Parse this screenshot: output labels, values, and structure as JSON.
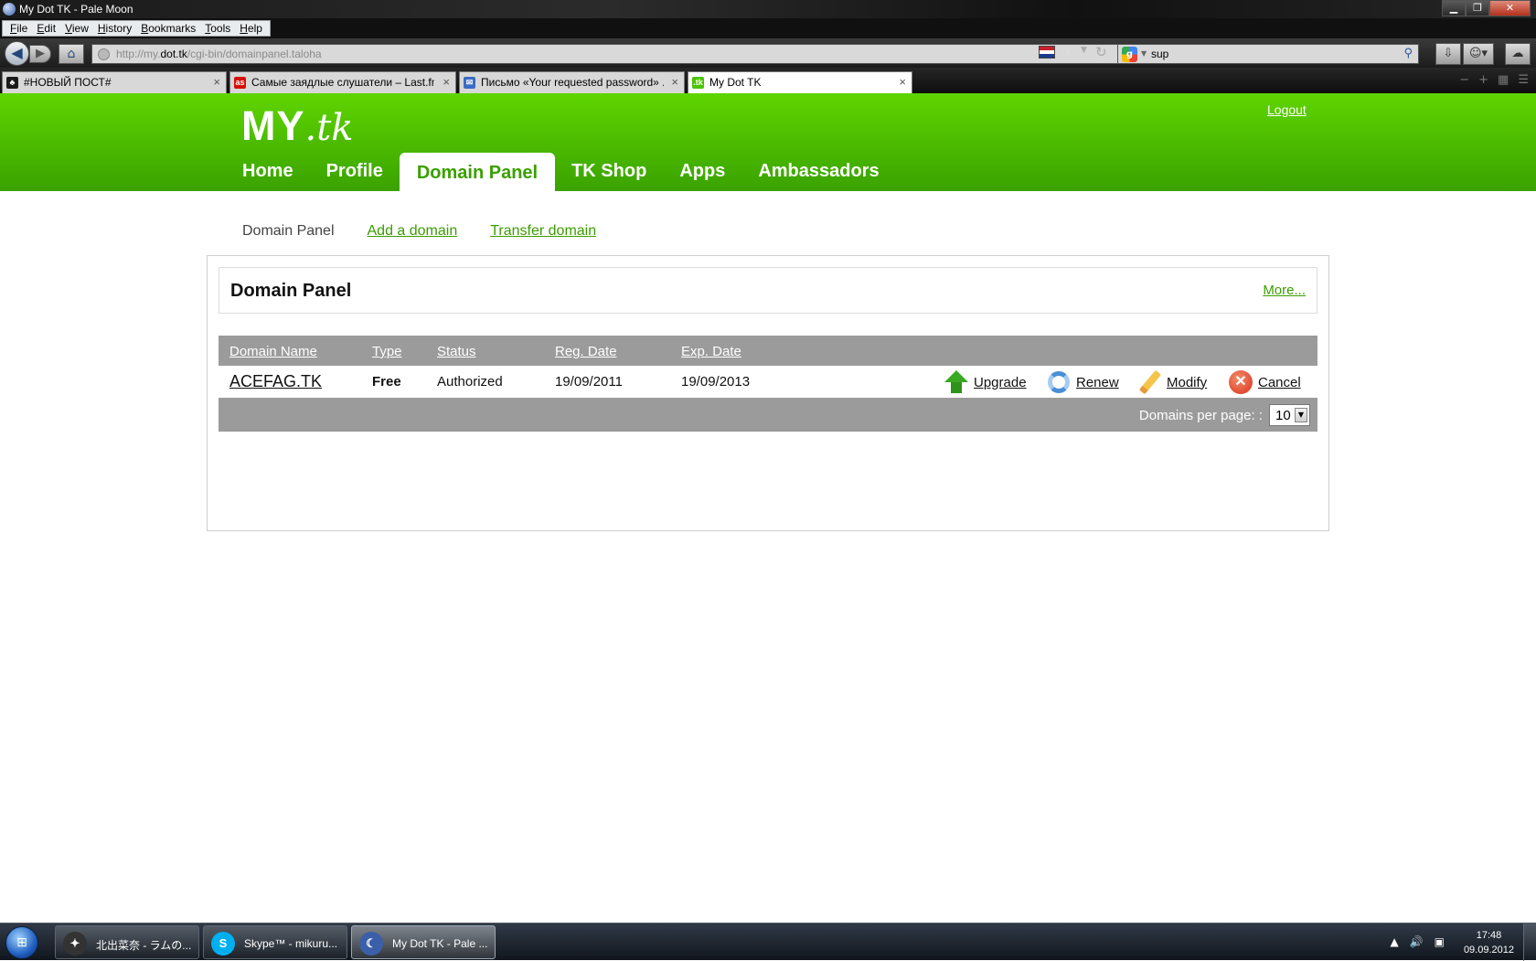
{
  "window": {
    "title": "My Dot TK - Pale Moon",
    "minimize": "▁",
    "restore": "❐",
    "close": "✕"
  },
  "menu": [
    "File",
    "Edit",
    "View",
    "History",
    "Bookmarks",
    "Tools",
    "Help"
  ],
  "urlbar": {
    "url_prefix": "http://my.",
    "url_domain": "dot.tk",
    "url_suffix": "/cgi-bin/domainpanel.taloha"
  },
  "search": {
    "engine_icon": "google-icon",
    "engine_letter": "g",
    "query": "sup"
  },
  "tabs": [
    {
      "label": "#НОВЫЙ ПОСТ#",
      "icon_color": "#1a1a1a",
      "icon_text": "♣"
    },
    {
      "label": "Самые заядлые слушатели – Last.fm",
      "icon_color": "#d51007",
      "icon_text": "as"
    },
    {
      "label": "Письмо «Your requested password» ...",
      "icon_color": "#3b6bc4",
      "icon_text": "✉"
    },
    {
      "label": "My Dot TK",
      "icon_color": "#4cc400",
      "icon_text": ".tk"
    }
  ],
  "site": {
    "logo_my": "MY",
    "logo_tk": ".tk",
    "logout": "Logout",
    "nav": [
      "Home",
      "Profile",
      "Domain Panel",
      "TK Shop",
      "Apps",
      "Ambassadors"
    ],
    "nav_active_index": 2,
    "subnav": {
      "current": "Domain Panel",
      "add": "Add a domain",
      "transfer": "Transfer domain"
    }
  },
  "panel": {
    "title": "Domain Panel",
    "more": "More...",
    "columns": [
      "Domain Name",
      "Type",
      "Status",
      "Reg. Date",
      "Exp. Date"
    ],
    "rows": [
      {
        "domain": "ACEFAG.TK",
        "type": "Free",
        "status": "Authorized",
        "reg_date": "19/09/2011",
        "exp_date": "19/09/2013"
      }
    ],
    "actions": {
      "upgrade": "Upgrade",
      "renew": "Renew",
      "modify": "Modify",
      "cancel": "Cancel"
    },
    "per_page_label": "Domains per page: :",
    "per_page_value": "10"
  },
  "taskbar": {
    "tasks": [
      {
        "label": "北出菜奈 - ラムの...",
        "icon_color": "#333333",
        "icon_text": "✦"
      },
      {
        "label": "Skype™ - mikuru...",
        "icon_color": "#00aff0",
        "icon_text": "S"
      },
      {
        "label": "My Dot TK - Pale ...",
        "icon_color": "#3b5fa8",
        "icon_text": "☾"
      }
    ],
    "time": "17:48",
    "date": "09.09.2012"
  },
  "colors": {
    "brand_green": "#4cc400",
    "link_green": "#3a9e00",
    "grid_gray": "#9b9b9b"
  }
}
